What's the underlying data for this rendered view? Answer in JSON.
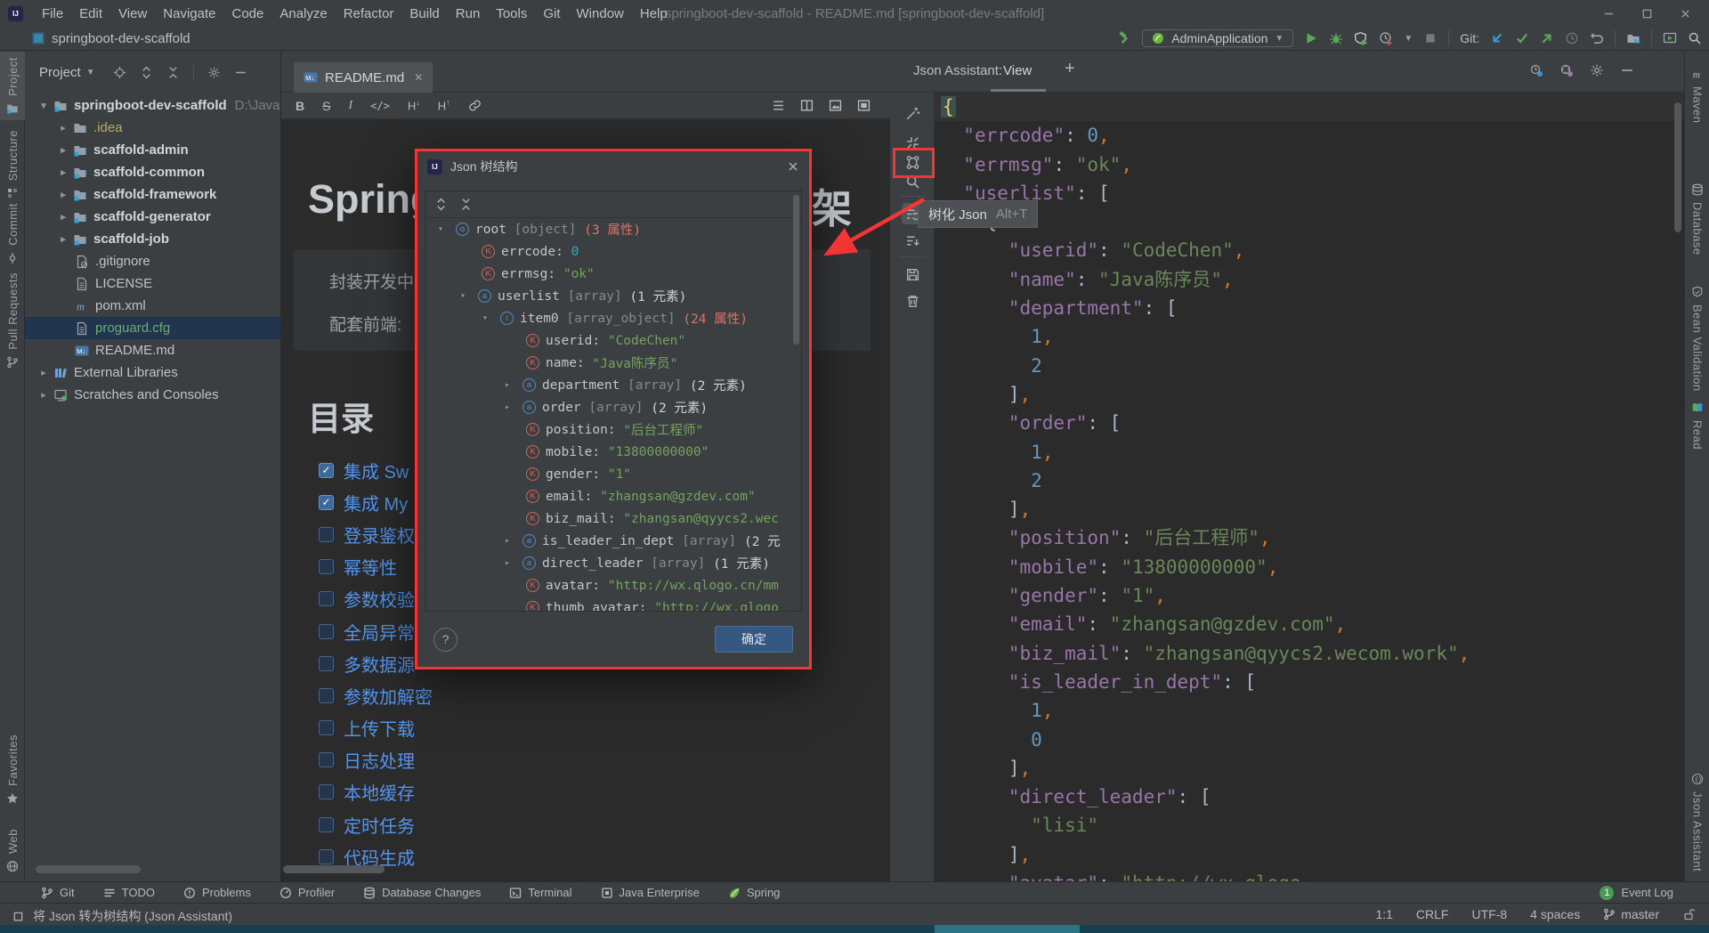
{
  "colors": {
    "link": "#5394ec",
    "green": "#499c54",
    "key": "#9876aa",
    "str": "#6a8759",
    "num": "#6897bb",
    "com": "#cc7832",
    "teal": "#2aacb8",
    "salmon": "#d5756c"
  },
  "titlebar": {
    "menu": [
      "File",
      "Edit",
      "View",
      "Navigate",
      "Code",
      "Analyze",
      "Refactor",
      "Build",
      "Run",
      "Tools",
      "Git",
      "Window",
      "Help"
    ],
    "title": "springboot-dev-scaffold - README.md [springboot-dev-scaffold]"
  },
  "navbar": {
    "project": "springboot-dev-scaffold",
    "run_config": "AdminApplication",
    "git_label": "Git:"
  },
  "left_bar": {
    "top": [
      {
        "label": "Project",
        "icon": "folderm",
        "selected": true
      },
      {
        "label": "Structure",
        "icon": "struct"
      },
      {
        "label": "Commit",
        "icon": "commit"
      },
      {
        "label": "Pull Requests",
        "icon": "branch"
      }
    ],
    "bottom": [
      {
        "label": "Favorites",
        "icon": "star"
      },
      {
        "label": "Web",
        "icon": "web"
      }
    ]
  },
  "right_bar": {
    "top": [
      {
        "label": "Maven",
        "icon": "mavenm"
      },
      {
        "label": "Database",
        "icon": "db"
      },
      {
        "label": "Bean Validation",
        "icon": "beanval"
      },
      {
        "label": "Read",
        "icon": "book"
      }
    ],
    "bottom": [
      {
        "label": "Json Assistant",
        "icon": "jsonic"
      }
    ]
  },
  "project": {
    "header": "Project",
    "tree": [
      {
        "lv": 0,
        "ch": "o",
        "ic": "folderm",
        "label": "springboot-dev-scaffold",
        "bold": true,
        "suffix": "D:\\JavaE"
      },
      {
        "lv": 1,
        "ch": "c",
        "ic": "folder",
        "label": ".idea",
        "cls": "olive"
      },
      {
        "lv": 1,
        "ch": "c",
        "ic": "folderm",
        "label": "scaffold-admin",
        "bold": true
      },
      {
        "lv": 1,
        "ch": "c",
        "ic": "folderm",
        "label": "scaffold-common",
        "bold": true
      },
      {
        "lv": 1,
        "ch": "c",
        "ic": "folderm",
        "label": "scaffold-framework",
        "bold": true
      },
      {
        "lv": 1,
        "ch": "c",
        "ic": "folderm",
        "label": "scaffold-generator",
        "bold": true
      },
      {
        "lv": 1,
        "ch": "c",
        "ic": "folderm",
        "label": "scaffold-job",
        "bold": true
      },
      {
        "lv": 1,
        "ic": "fileig",
        "label": ".gitignore"
      },
      {
        "lv": 1,
        "ic": "file",
        "label": "LICENSE"
      },
      {
        "lv": 1,
        "ic": "maven",
        "label": "pom.xml"
      },
      {
        "lv": 1,
        "ic": "file",
        "label": "proguard.cfg",
        "sel": true,
        "cls": "green"
      },
      {
        "lv": 1,
        "ic": "markdown",
        "label": "README.md"
      },
      {
        "lv": 0,
        "ch": "c",
        "ic": "library",
        "label": "External Libraries"
      },
      {
        "lv": 0,
        "ch": "c",
        "ic": "scratch",
        "label": "Scratches and Consoles"
      }
    ]
  },
  "editor": {
    "tab": "README.md",
    "heading_left": "Spring",
    "heading_right": "架",
    "quote_lines": [
      "封装开发中",
      "配套前端:"
    ],
    "toc": "目录",
    "checklist": [
      {
        "label": "集成 Sw",
        "checked": true
      },
      {
        "label": "集成 My",
        "checked": true
      },
      {
        "label": "登录鉴权",
        "checked": false
      },
      {
        "label": "幂等性",
        "checked": false
      },
      {
        "label": "参数校验",
        "checked": false
      },
      {
        "label": "全局异常",
        "checked": false
      },
      {
        "label": "多数据源",
        "checked": false
      },
      {
        "label": "参数加解密",
        "checked": false
      },
      {
        "label": "上传下载",
        "checked": false
      },
      {
        "label": "日志处理",
        "checked": false
      },
      {
        "label": "本地缓存",
        "checked": false
      },
      {
        "label": "定时任务",
        "checked": false
      },
      {
        "label": "代码生成",
        "checked": false
      }
    ]
  },
  "dialog": {
    "title": "Json 树结构",
    "ok": "确定",
    "help": "?",
    "tree": [
      {
        "l": 0,
        "ch": "o",
        "ic": "obj",
        "n": "root",
        "ty": "[object]",
        "ct": "(3 属性)",
        "cc": "a"
      },
      {
        "l": 1,
        "ic": "key",
        "n": "errcode",
        "v": "0",
        "vc": "n"
      },
      {
        "l": 1,
        "ic": "key",
        "n": "errmsg",
        "v": "\"ok\"",
        "vc": "s"
      },
      {
        "l": 1,
        "ch": "o",
        "ic": "arr",
        "n": "userlist",
        "ty": "[array]",
        "ct": "(1 元素)",
        "cc": "e"
      },
      {
        "l": 2,
        "ch": "o",
        "ic": "item",
        "n": "item0",
        "ty": "[array_object]",
        "ct": "(24 属性)",
        "cc": "a"
      },
      {
        "l": 3,
        "ic": "key",
        "n": "userid",
        "v": "\"CodeChen\"",
        "vc": "s"
      },
      {
        "l": 3,
        "ic": "key",
        "n": "name",
        "v": "\"Java陈序员\"",
        "vc": "s"
      },
      {
        "l": 3,
        "ch": "c",
        "ic": "arr",
        "n": "department",
        "ty": "[array]",
        "ct": "(2 元素)",
        "cc": "e"
      },
      {
        "l": 3,
        "ch": "c",
        "ic": "arr",
        "n": "order",
        "ty": "[array]",
        "ct": "(2 元素)",
        "cc": "e"
      },
      {
        "l": 3,
        "ic": "key",
        "n": "position",
        "v": "\"后台工程师\"",
        "vc": "s"
      },
      {
        "l": 3,
        "ic": "key",
        "n": "mobile",
        "v": "\"13800000000\"",
        "vc": "s"
      },
      {
        "l": 3,
        "ic": "key",
        "n": "gender",
        "v": "\"1\"",
        "vc": "s"
      },
      {
        "l": 3,
        "ic": "key",
        "n": "email",
        "v": "\"zhangsan@gzdev.com\"",
        "vc": "s"
      },
      {
        "l": 3,
        "ic": "key",
        "n": "biz_mail",
        "v": "\"zhangsan@qyycs2.wec",
        "vc": "s"
      },
      {
        "l": 3,
        "ch": "c",
        "ic": "arr",
        "n": "is_leader_in_dept",
        "ty": "[array]",
        "ct": "(2 元",
        "cc": "e"
      },
      {
        "l": 3,
        "ch": "c",
        "ic": "arr",
        "n": "direct_leader",
        "ty": "[array]",
        "ct": "(1 元素)",
        "cc": "e"
      },
      {
        "l": 3,
        "ic": "key",
        "n": "avatar",
        "v": "\"http://wx.qlogo.cn/mm",
        "vc": "s"
      },
      {
        "l": 3,
        "ic": "key",
        "n": "thumb_avatar",
        "v": "\"http://wx.qlogo",
        "vc": "s"
      }
    ]
  },
  "tooltip": {
    "text": "树化 Json",
    "shortcut": "Alt+T"
  },
  "json_panel": {
    "label": "Json Assistant:",
    "tab": "View",
    "add": "+",
    "lines": [
      {
        "c": true,
        "t": [
          [
            "b",
            "{"
          ]
        ]
      },
      {
        "t": [
          [
            "w",
            "  "
          ],
          [
            "k",
            "\"errcode\""
          ],
          [
            "p",
            ": "
          ],
          [
            "n",
            "0"
          ],
          [
            "c",
            ","
          ]
        ]
      },
      {
        "t": [
          [
            "w",
            "  "
          ],
          [
            "k",
            "\"errmsg\""
          ],
          [
            "p",
            ": "
          ],
          [
            "s",
            "\"ok\""
          ],
          [
            "c",
            ","
          ]
        ]
      },
      {
        "t": [
          [
            "w",
            "  "
          ],
          [
            "k",
            "\"userlist\""
          ],
          [
            "p",
            ": "
          ],
          [
            "w",
            "["
          ]
        ]
      },
      {
        "t": [
          [
            "w",
            "    {"
          ]
        ]
      },
      {
        "t": [
          [
            "w",
            "      "
          ],
          [
            "k",
            "\"userid\""
          ],
          [
            "p",
            ": "
          ],
          [
            "s",
            "\"CodeChen\""
          ],
          [
            "c",
            ","
          ]
        ]
      },
      {
        "t": [
          [
            "w",
            "      "
          ],
          [
            "k",
            "\"name\""
          ],
          [
            "p",
            ": "
          ],
          [
            "s",
            "\"Java陈序员\""
          ],
          [
            "c",
            ","
          ]
        ]
      },
      {
        "t": [
          [
            "w",
            "      "
          ],
          [
            "k",
            "\"department\""
          ],
          [
            "p",
            ": "
          ],
          [
            "w",
            "["
          ]
        ]
      },
      {
        "t": [
          [
            "w",
            "        "
          ],
          [
            "n",
            "1"
          ],
          [
            "c",
            ","
          ]
        ]
      },
      {
        "t": [
          [
            "w",
            "        "
          ],
          [
            "n",
            "2"
          ]
        ]
      },
      {
        "t": [
          [
            "w",
            "      ]"
          ],
          [
            "c",
            ","
          ]
        ]
      },
      {
        "t": [
          [
            "w",
            "      "
          ],
          [
            "k",
            "\"order\""
          ],
          [
            "p",
            ": "
          ],
          [
            "w",
            "["
          ]
        ]
      },
      {
        "t": [
          [
            "w",
            "        "
          ],
          [
            "n",
            "1"
          ],
          [
            "c",
            ","
          ]
        ]
      },
      {
        "t": [
          [
            "w",
            "        "
          ],
          [
            "n",
            "2"
          ]
        ]
      },
      {
        "t": [
          [
            "w",
            "      ]"
          ],
          [
            "c",
            ","
          ]
        ]
      },
      {
        "t": [
          [
            "w",
            "      "
          ],
          [
            "k",
            "\"position\""
          ],
          [
            "p",
            ": "
          ],
          [
            "s",
            "\"后台工程师\""
          ],
          [
            "c",
            ","
          ]
        ]
      },
      {
        "t": [
          [
            "w",
            "      "
          ],
          [
            "k",
            "\"mobile\""
          ],
          [
            "p",
            ": "
          ],
          [
            "s",
            "\"13800000000\""
          ],
          [
            "c",
            ","
          ]
        ]
      },
      {
        "t": [
          [
            "w",
            "      "
          ],
          [
            "k",
            "\"gender\""
          ],
          [
            "p",
            ": "
          ],
          [
            "s",
            "\"1\""
          ],
          [
            "c",
            ","
          ]
        ]
      },
      {
        "t": [
          [
            "w",
            "      "
          ],
          [
            "k",
            "\"email\""
          ],
          [
            "p",
            ": "
          ],
          [
            "s",
            "\"zhangsan@gzdev.com\""
          ],
          [
            "c",
            ","
          ]
        ]
      },
      {
        "t": [
          [
            "w",
            "      "
          ],
          [
            "k",
            "\"biz_mail\""
          ],
          [
            "p",
            ": "
          ],
          [
            "s",
            "\"zhangsan@qyycs2.wecom.work\""
          ],
          [
            "c",
            ","
          ]
        ]
      },
      {
        "t": [
          [
            "w",
            "      "
          ],
          [
            "k",
            "\"is_leader_in_dept\""
          ],
          [
            "p",
            ": "
          ],
          [
            "w",
            "["
          ]
        ]
      },
      {
        "t": [
          [
            "w",
            "        "
          ],
          [
            "n",
            "1"
          ],
          [
            "c",
            ","
          ]
        ]
      },
      {
        "t": [
          [
            "w",
            "        "
          ],
          [
            "n",
            "0"
          ]
        ]
      },
      {
        "t": [
          [
            "w",
            "      ]"
          ],
          [
            "c",
            ","
          ]
        ]
      },
      {
        "t": [
          [
            "w",
            "      "
          ],
          [
            "k",
            "\"direct_leader\""
          ],
          [
            "p",
            ": "
          ],
          [
            "w",
            "["
          ]
        ]
      },
      {
        "t": [
          [
            "w",
            "        "
          ],
          [
            "s",
            "\"lisi\""
          ]
        ]
      },
      {
        "t": [
          [
            "w",
            "      ]"
          ],
          [
            "c",
            ","
          ]
        ]
      },
      {
        "t": [
          [
            "w",
            "      "
          ],
          [
            "k",
            "\"avatar\""
          ],
          [
            "p",
            ": "
          ],
          [
            "s",
            "\"http://wx.qlogo"
          ]
        ]
      }
    ]
  },
  "bottombar": {
    "items": [
      {
        "label": "Git",
        "icon": "branch"
      },
      {
        "label": "TODO",
        "icon": "todo"
      },
      {
        "label": "Problems",
        "icon": "problem"
      },
      {
        "label": "Profiler",
        "icon": "gauge"
      },
      {
        "label": "Database Changes",
        "icon": "dbch"
      },
      {
        "label": "Terminal",
        "icon": "terminal"
      },
      {
        "label": "Java Enterprise",
        "icon": "javaee"
      },
      {
        "label": "Spring",
        "icon": "leaf"
      }
    ],
    "event_log": {
      "count": "1",
      "label": "Event Log"
    }
  },
  "statusbar": {
    "message": "将 Json 转为树结构 (Json Assistant)",
    "items": [
      "1:1",
      "CRLF",
      "UTF-8",
      "4 spaces"
    ],
    "branch": "master"
  }
}
